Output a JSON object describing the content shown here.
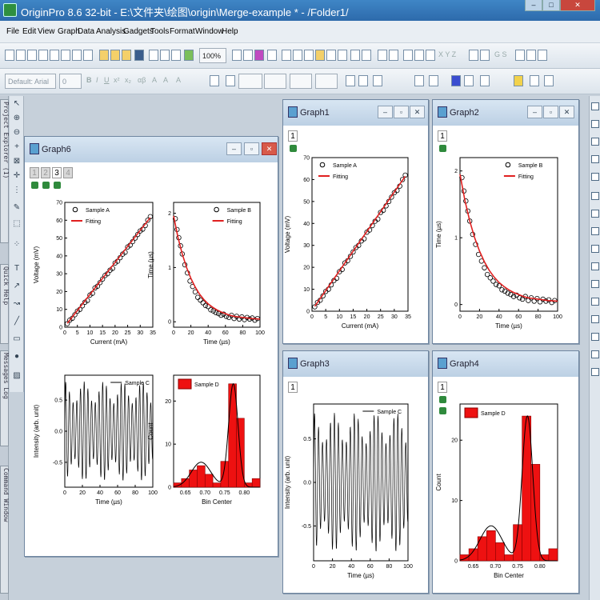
{
  "app": {
    "title": "OriginPro 8.6 32-bit - E:\\文件夹\\绘图\\origin\\Merge-example * - /Folder1/"
  },
  "menu": [
    "File",
    "Edit",
    "View",
    "Graph",
    "Data",
    "Analysis",
    "Gadgets",
    "Tools",
    "Format",
    "Window",
    "Help"
  ],
  "toolbar": {
    "zoom": "100%",
    "font": "Default: Arial",
    "font_size": "0",
    "axis_letters": "X Y Z",
    "gs": "G S"
  },
  "side_panels": [
    "Project Explorer (1)",
    "Quick Help",
    "Messages Log",
    "Command Window"
  ],
  "windows": [
    {
      "name": "Graph6",
      "layers": [
        "1",
        "2",
        "3",
        "4"
      ]
    },
    {
      "name": "Graph1",
      "layers": [
        "1"
      ]
    },
    {
      "name": "Graph2",
      "layers": [
        "1"
      ]
    },
    {
      "name": "Graph3",
      "layers": [
        "1"
      ]
    },
    {
      "name": "Graph4",
      "layers": [
        "1"
      ]
    }
  ],
  "colors": {
    "fit": "#e02020",
    "bar": "#ee1111",
    "bar_edge": "#8a0000",
    "frame": "#6f86a0"
  },
  "chart_data": [
    {
      "id": "voltage",
      "type": "scatter",
      "series": [
        {
          "name": "Sample A",
          "x": [
            1,
            2,
            3,
            4,
            5,
            6,
            7,
            8,
            9,
            10,
            11,
            12,
            13,
            14,
            15,
            16,
            17,
            18,
            19,
            20,
            21,
            22,
            23,
            24,
            25,
            26,
            27,
            28,
            29,
            30,
            31,
            32,
            33,
            34
          ],
          "y": [
            2,
            4,
            5,
            7,
            9,
            10,
            12,
            14,
            15,
            18,
            19,
            22,
            23,
            25,
            27,
            29,
            30,
            32,
            33,
            36,
            37,
            39,
            41,
            42,
            45,
            46,
            48,
            50,
            52,
            54,
            55,
            57,
            60,
            62
          ]
        },
        {
          "name": "Fitting",
          "x": [
            1,
            34
          ],
          "y": [
            2.2,
            61.5
          ]
        }
      ],
      "xlabel": "Current (mA)",
      "ylabel": "Voltage (mV)",
      "xticks": [
        "0",
        "5",
        "10",
        "15",
        "20",
        "25",
        "30",
        "35"
      ],
      "yticks": [
        "0",
        "10",
        "20",
        "30",
        "40",
        "50",
        "60",
        "70"
      ],
      "xlim": [
        0,
        35
      ],
      "ylim": [
        0,
        70
      ]
    },
    {
      "id": "time",
      "type": "scatter",
      "series": [
        {
          "name": "Sample B",
          "x": [
            2,
            4,
            6,
            8,
            10,
            13,
            16,
            19,
            22,
            25,
            28,
            31,
            34,
            37,
            40,
            43,
            46,
            49,
            52,
            55,
            58,
            61,
            64,
            67,
            70,
            73,
            76,
            79,
            82,
            85,
            88,
            91,
            94,
            97
          ],
          "y": [
            1.9,
            1.7,
            1.55,
            1.4,
            1.25,
            1.05,
            0.9,
            0.75,
            0.65,
            0.55,
            0.45,
            0.4,
            0.35,
            0.3,
            0.28,
            0.22,
            0.2,
            0.17,
            0.15,
            0.12,
            0.14,
            0.1,
            0.08,
            0.12,
            0.06,
            0.1,
            0.05,
            0.09,
            0.04,
            0.08,
            0.05,
            0.07,
            0.03,
            0.06
          ]
        },
        {
          "name": "Fitting",
          "x": [
            0,
            5,
            10,
            15,
            20,
            25,
            30,
            35,
            40,
            45,
            50,
            55,
            60,
            65,
            70,
            75,
            80,
            85,
            90,
            95,
            100
          ],
          "y": [
            1.95,
            1.56,
            1.25,
            1.0,
            0.8,
            0.64,
            0.51,
            0.41,
            0.33,
            0.27,
            0.22,
            0.18,
            0.15,
            0.12,
            0.1,
            0.09,
            0.08,
            0.07,
            0.06,
            0.055,
            0.05
          ]
        }
      ],
      "xlabel": "Time (µs)",
      "ylabel": "Time (µs)",
      "xticks": [
        "0",
        "20",
        "40",
        "60",
        "80",
        "100"
      ],
      "yticks": [
        "0",
        "1",
        "2"
      ],
      "xlim": [
        0,
        100
      ],
      "ylim": [
        -0.1,
        2.2
      ]
    },
    {
      "id": "intensity",
      "type": "line",
      "series": [
        {
          "name": "Sample C",
          "amplitude": 0.8,
          "period": 4.2,
          "mod_period": 22
        }
      ],
      "xlabel": "Time (µs)",
      "ylabel": "Intensity (arb. unit)",
      "xticks": [
        "0",
        "20",
        "40",
        "60",
        "80",
        "100"
      ],
      "yticks": [
        "-0.5",
        "0.0",
        "0.5"
      ],
      "xlim": [
        0,
        100
      ],
      "ylim": [
        -0.9,
        0.9
      ]
    },
    {
      "id": "histogram",
      "type": "bar",
      "series": [
        {
          "name": "Sample D",
          "x": [
            0.63,
            0.65,
            0.67,
            0.69,
            0.71,
            0.73,
            0.75,
            0.77,
            0.79,
            0.81,
            0.83
          ],
          "values": [
            1,
            2,
            4,
            5,
            3,
            1,
            6,
            24,
            16,
            1,
            2
          ]
        }
      ],
      "fits": [
        {
          "center": 0.69,
          "sigma": 0.025,
          "height": 5.8
        },
        {
          "center": 0.772,
          "sigma": 0.012,
          "height": 24
        }
      ],
      "xlabel": "Bin Center",
      "ylabel": "Count",
      "xticks": [
        "0.65",
        "0.70",
        "0.75",
        "0.80"
      ],
      "yticks": [
        "0",
        "10",
        "20"
      ],
      "xlim": [
        0.62,
        0.84
      ],
      "ylim": [
        0,
        26
      ]
    }
  ]
}
